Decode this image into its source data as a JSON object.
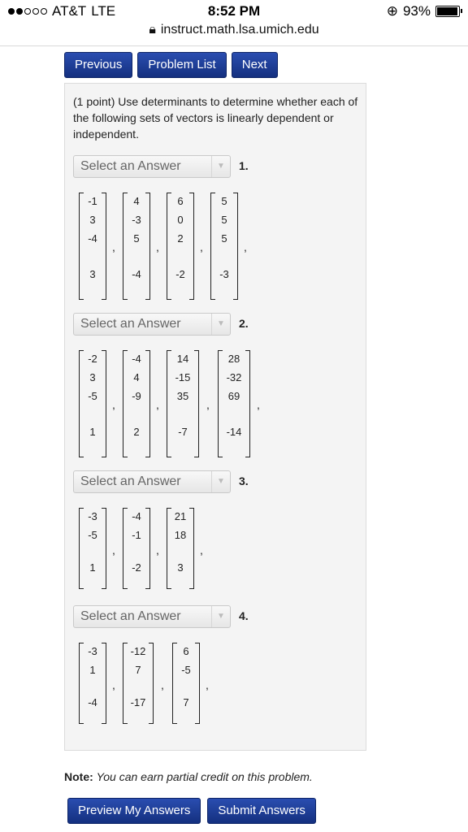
{
  "status": {
    "carrier": "AT&T",
    "network": "LTE",
    "time": "8:52 PM",
    "battery": "93%"
  },
  "browser": {
    "url": "instruct.math.lsa.umich.edu"
  },
  "nav": {
    "previous": "Previous",
    "problem_list": "Problem List",
    "next": "Next"
  },
  "problem": {
    "intro": "(1 point) Use determinants to determine whether each of the following sets of vectors is linearly dependent or independent.",
    "questions": [
      {
        "select": "Select an Answer",
        "num": "1.",
        "vectors": [
          [
            "-1",
            "3",
            "-4",
            "3"
          ],
          [
            "4",
            "-3",
            "5",
            "-4"
          ],
          [
            "6",
            "0",
            "2",
            "-2"
          ],
          [
            "5",
            "5",
            "5",
            "-3"
          ]
        ]
      },
      {
        "select": "Select an Answer",
        "num": "2.",
        "vectors": [
          [
            "-2",
            "3",
            "-5",
            "1"
          ],
          [
            "-4",
            "4",
            "-9",
            "2"
          ],
          [
            "14",
            "-15",
            "35",
            "-7"
          ],
          [
            "28",
            "-32",
            "69",
            "-14"
          ]
        ]
      },
      {
        "select": "Select an Answer",
        "num": "3.",
        "vectors": [
          [
            "-3",
            "-5",
            "1"
          ],
          [
            "-4",
            "-1",
            "-2"
          ],
          [
            "21",
            "18",
            "3"
          ]
        ]
      },
      {
        "select": "Select an Answer",
        "num": "4.",
        "vectors": [
          [
            "-3",
            "1",
            "-4"
          ],
          [
            "-12",
            "7",
            "-17"
          ],
          [
            "6",
            "-5",
            "7"
          ]
        ]
      }
    ],
    "comma": ","
  },
  "note": {
    "label": "Note:",
    "text": "You can earn partial credit on this problem."
  },
  "actions": {
    "preview": "Preview My Answers",
    "submit": "Submit Answers"
  }
}
